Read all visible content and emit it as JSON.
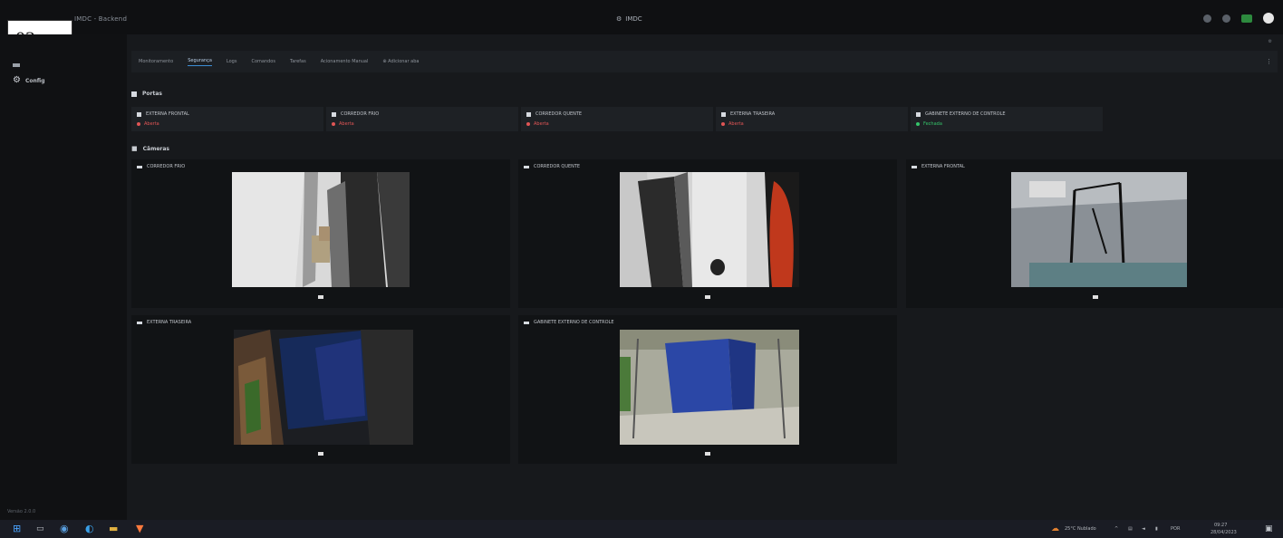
{
  "window": {
    "title": "IMDC - Backend",
    "center_title": "IMDC"
  },
  "stamp": "02",
  "sidebar": {
    "config_label": "Config",
    "version": "Versão 2.0.0"
  },
  "tabs": [
    "Monitoramento",
    "Segurança",
    "Logs",
    "Comandos",
    "Tarefas",
    "Acionamento Manual",
    "Adicionar aba"
  ],
  "active_tab": 1,
  "doors_section": "Portas",
  "doors": [
    {
      "name": "EXTERNA FRONTAL",
      "status": "Aberta",
      "status_color": "#e05555"
    },
    {
      "name": "CORREDOR FRIO",
      "status": "Aberta",
      "status_color": "#e05555"
    },
    {
      "name": "CORREDOR QUENTE",
      "status": "Aberta",
      "status_color": "#e05555"
    },
    {
      "name": "EXTERNA TRASEIRA",
      "status": "Aberta",
      "status_color": "#e05555"
    },
    {
      "name": "GABINETE EXTERNO DE CONTROLE",
      "status": "Fechada",
      "status_color": "#35c46a"
    }
  ],
  "cameras_section": "Câmeras",
  "cameras": [
    {
      "name": "CORREDOR FRIO"
    },
    {
      "name": "CORREDOR QUENTE"
    },
    {
      "name": "EXTERNA FRONTAL"
    },
    {
      "name": "EXTERNA TRASEIRA"
    },
    {
      "name": "GABINETE EXTERNO DE CONTROLE"
    }
  ],
  "taskbar": {
    "weather": "25°C Nublado",
    "time": "09:27",
    "date": "28/04/2023",
    "lang": "POR"
  },
  "colors": {
    "accent": "#3c8ed6",
    "open": "#e05555",
    "closed": "#35c46a"
  }
}
